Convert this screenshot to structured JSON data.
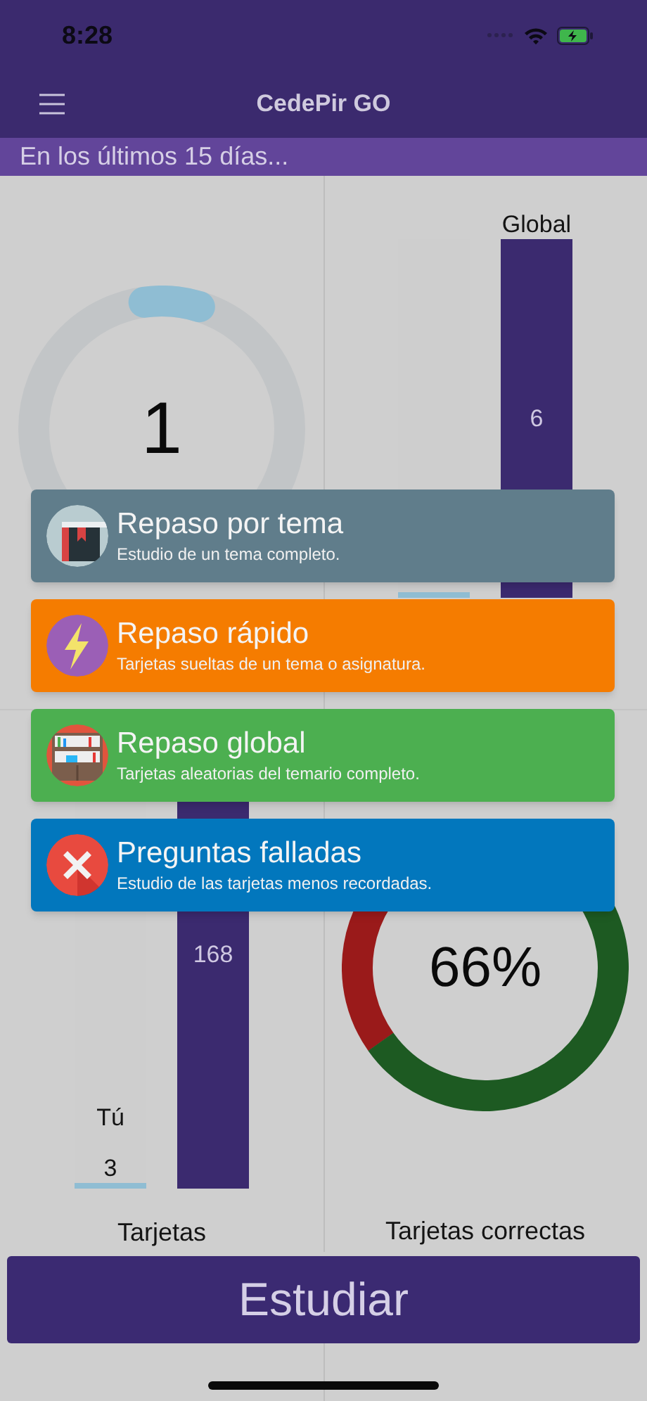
{
  "status_bar": {
    "time": "8:28"
  },
  "nav_bar": {
    "title": "CedePir GO"
  },
  "period_banner": "En los últimos 15 días...",
  "stats": [
    {
      "kind": "ring",
      "value": "1",
      "level": 0.07
    },
    {
      "kind": "bars",
      "bars": [
        {
          "level": 0.016
        },
        {
          "label": "Global",
          "value": "6",
          "level": 1
        }
      ]
    },
    {
      "kind": "bars",
      "label": "Tarjetas",
      "bars": [
        {
          "label": "Tú",
          "value": "3",
          "level": 0.012
        },
        {
          "value": "168",
          "level": 1
        }
      ]
    },
    {
      "kind": "split_ring",
      "value": "66%",
      "level": 0.66,
      "label": "Tarjetas correctas"
    }
  ],
  "study_menu": [
    {
      "title": "Repaso por tema",
      "subtitle": "Estudio de un tema completo.",
      "color": "#607d8b"
    },
    {
      "title": "Repaso rápido",
      "subtitle": "Tarjetas sueltas de un tema o asignatura.",
      "color": "#f57c00"
    },
    {
      "title": "Repaso global",
      "subtitle": "Tarjetas aleatorias del temario completo.",
      "color": "#4caf50"
    },
    {
      "title": "Preguntas falladas",
      "subtitle": "Estudio de las tarjetas menos recordadas.",
      "color": "#0277bd"
    }
  ],
  "study_button": "Estudiar"
}
